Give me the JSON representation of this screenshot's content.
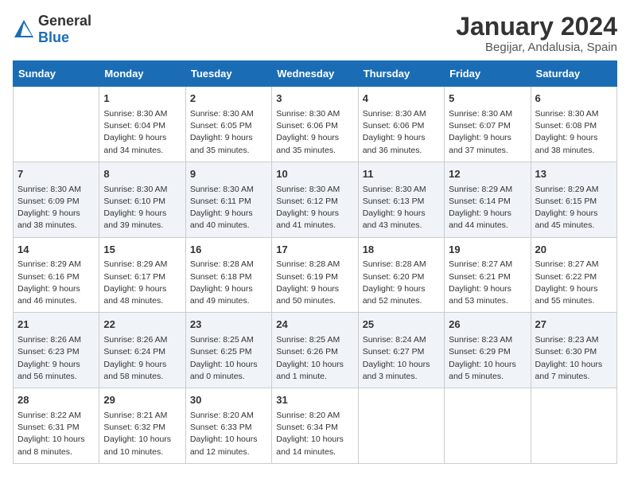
{
  "header": {
    "logo_general": "General",
    "logo_blue": "Blue",
    "title": "January 2024",
    "subtitle": "Begijar, Andalusia, Spain"
  },
  "days_of_week": [
    "Sunday",
    "Monday",
    "Tuesday",
    "Wednesday",
    "Thursday",
    "Friday",
    "Saturday"
  ],
  "weeks": [
    [
      {
        "day": "",
        "sunrise": "",
        "sunset": "",
        "daylight": ""
      },
      {
        "day": "1",
        "sunrise": "Sunrise: 8:30 AM",
        "sunset": "Sunset: 6:04 PM",
        "daylight": "Daylight: 9 hours and 34 minutes."
      },
      {
        "day": "2",
        "sunrise": "Sunrise: 8:30 AM",
        "sunset": "Sunset: 6:05 PM",
        "daylight": "Daylight: 9 hours and 35 minutes."
      },
      {
        "day": "3",
        "sunrise": "Sunrise: 8:30 AM",
        "sunset": "Sunset: 6:06 PM",
        "daylight": "Daylight: 9 hours and 35 minutes."
      },
      {
        "day": "4",
        "sunrise": "Sunrise: 8:30 AM",
        "sunset": "Sunset: 6:06 PM",
        "daylight": "Daylight: 9 hours and 36 minutes."
      },
      {
        "day": "5",
        "sunrise": "Sunrise: 8:30 AM",
        "sunset": "Sunset: 6:07 PM",
        "daylight": "Daylight: 9 hours and 37 minutes."
      },
      {
        "day": "6",
        "sunrise": "Sunrise: 8:30 AM",
        "sunset": "Sunset: 6:08 PM",
        "daylight": "Daylight: 9 hours and 38 minutes."
      }
    ],
    [
      {
        "day": "7",
        "sunrise": "Sunrise: 8:30 AM",
        "sunset": "Sunset: 6:09 PM",
        "daylight": "Daylight: 9 hours and 38 minutes."
      },
      {
        "day": "8",
        "sunrise": "Sunrise: 8:30 AM",
        "sunset": "Sunset: 6:10 PM",
        "daylight": "Daylight: 9 hours and 39 minutes."
      },
      {
        "day": "9",
        "sunrise": "Sunrise: 8:30 AM",
        "sunset": "Sunset: 6:11 PM",
        "daylight": "Daylight: 9 hours and 40 minutes."
      },
      {
        "day": "10",
        "sunrise": "Sunrise: 8:30 AM",
        "sunset": "Sunset: 6:12 PM",
        "daylight": "Daylight: 9 hours and 41 minutes."
      },
      {
        "day": "11",
        "sunrise": "Sunrise: 8:30 AM",
        "sunset": "Sunset: 6:13 PM",
        "daylight": "Daylight: 9 hours and 43 minutes."
      },
      {
        "day": "12",
        "sunrise": "Sunrise: 8:29 AM",
        "sunset": "Sunset: 6:14 PM",
        "daylight": "Daylight: 9 hours and 44 minutes."
      },
      {
        "day": "13",
        "sunrise": "Sunrise: 8:29 AM",
        "sunset": "Sunset: 6:15 PM",
        "daylight": "Daylight: 9 hours and 45 minutes."
      }
    ],
    [
      {
        "day": "14",
        "sunrise": "Sunrise: 8:29 AM",
        "sunset": "Sunset: 6:16 PM",
        "daylight": "Daylight: 9 hours and 46 minutes."
      },
      {
        "day": "15",
        "sunrise": "Sunrise: 8:29 AM",
        "sunset": "Sunset: 6:17 PM",
        "daylight": "Daylight: 9 hours and 48 minutes."
      },
      {
        "day": "16",
        "sunrise": "Sunrise: 8:28 AM",
        "sunset": "Sunset: 6:18 PM",
        "daylight": "Daylight: 9 hours and 49 minutes."
      },
      {
        "day": "17",
        "sunrise": "Sunrise: 8:28 AM",
        "sunset": "Sunset: 6:19 PM",
        "daylight": "Daylight: 9 hours and 50 minutes."
      },
      {
        "day": "18",
        "sunrise": "Sunrise: 8:28 AM",
        "sunset": "Sunset: 6:20 PM",
        "daylight": "Daylight: 9 hours and 52 minutes."
      },
      {
        "day": "19",
        "sunrise": "Sunrise: 8:27 AM",
        "sunset": "Sunset: 6:21 PM",
        "daylight": "Daylight: 9 hours and 53 minutes."
      },
      {
        "day": "20",
        "sunrise": "Sunrise: 8:27 AM",
        "sunset": "Sunset: 6:22 PM",
        "daylight": "Daylight: 9 hours and 55 minutes."
      }
    ],
    [
      {
        "day": "21",
        "sunrise": "Sunrise: 8:26 AM",
        "sunset": "Sunset: 6:23 PM",
        "daylight": "Daylight: 9 hours and 56 minutes."
      },
      {
        "day": "22",
        "sunrise": "Sunrise: 8:26 AM",
        "sunset": "Sunset: 6:24 PM",
        "daylight": "Daylight: 9 hours and 58 minutes."
      },
      {
        "day": "23",
        "sunrise": "Sunrise: 8:25 AM",
        "sunset": "Sunset: 6:25 PM",
        "daylight": "Daylight: 10 hours and 0 minutes."
      },
      {
        "day": "24",
        "sunrise": "Sunrise: 8:25 AM",
        "sunset": "Sunset: 6:26 PM",
        "daylight": "Daylight: 10 hours and 1 minute."
      },
      {
        "day": "25",
        "sunrise": "Sunrise: 8:24 AM",
        "sunset": "Sunset: 6:27 PM",
        "daylight": "Daylight: 10 hours and 3 minutes."
      },
      {
        "day": "26",
        "sunrise": "Sunrise: 8:23 AM",
        "sunset": "Sunset: 6:29 PM",
        "daylight": "Daylight: 10 hours and 5 minutes."
      },
      {
        "day": "27",
        "sunrise": "Sunrise: 8:23 AM",
        "sunset": "Sunset: 6:30 PM",
        "daylight": "Daylight: 10 hours and 7 minutes."
      }
    ],
    [
      {
        "day": "28",
        "sunrise": "Sunrise: 8:22 AM",
        "sunset": "Sunset: 6:31 PM",
        "daylight": "Daylight: 10 hours and 8 minutes."
      },
      {
        "day": "29",
        "sunrise": "Sunrise: 8:21 AM",
        "sunset": "Sunset: 6:32 PM",
        "daylight": "Daylight: 10 hours and 10 minutes."
      },
      {
        "day": "30",
        "sunrise": "Sunrise: 8:20 AM",
        "sunset": "Sunset: 6:33 PM",
        "daylight": "Daylight: 10 hours and 12 minutes."
      },
      {
        "day": "31",
        "sunrise": "Sunrise: 8:20 AM",
        "sunset": "Sunset: 6:34 PM",
        "daylight": "Daylight: 10 hours and 14 minutes."
      },
      {
        "day": "",
        "sunrise": "",
        "sunset": "",
        "daylight": ""
      },
      {
        "day": "",
        "sunrise": "",
        "sunset": "",
        "daylight": ""
      },
      {
        "day": "",
        "sunrise": "",
        "sunset": "",
        "daylight": ""
      }
    ]
  ]
}
